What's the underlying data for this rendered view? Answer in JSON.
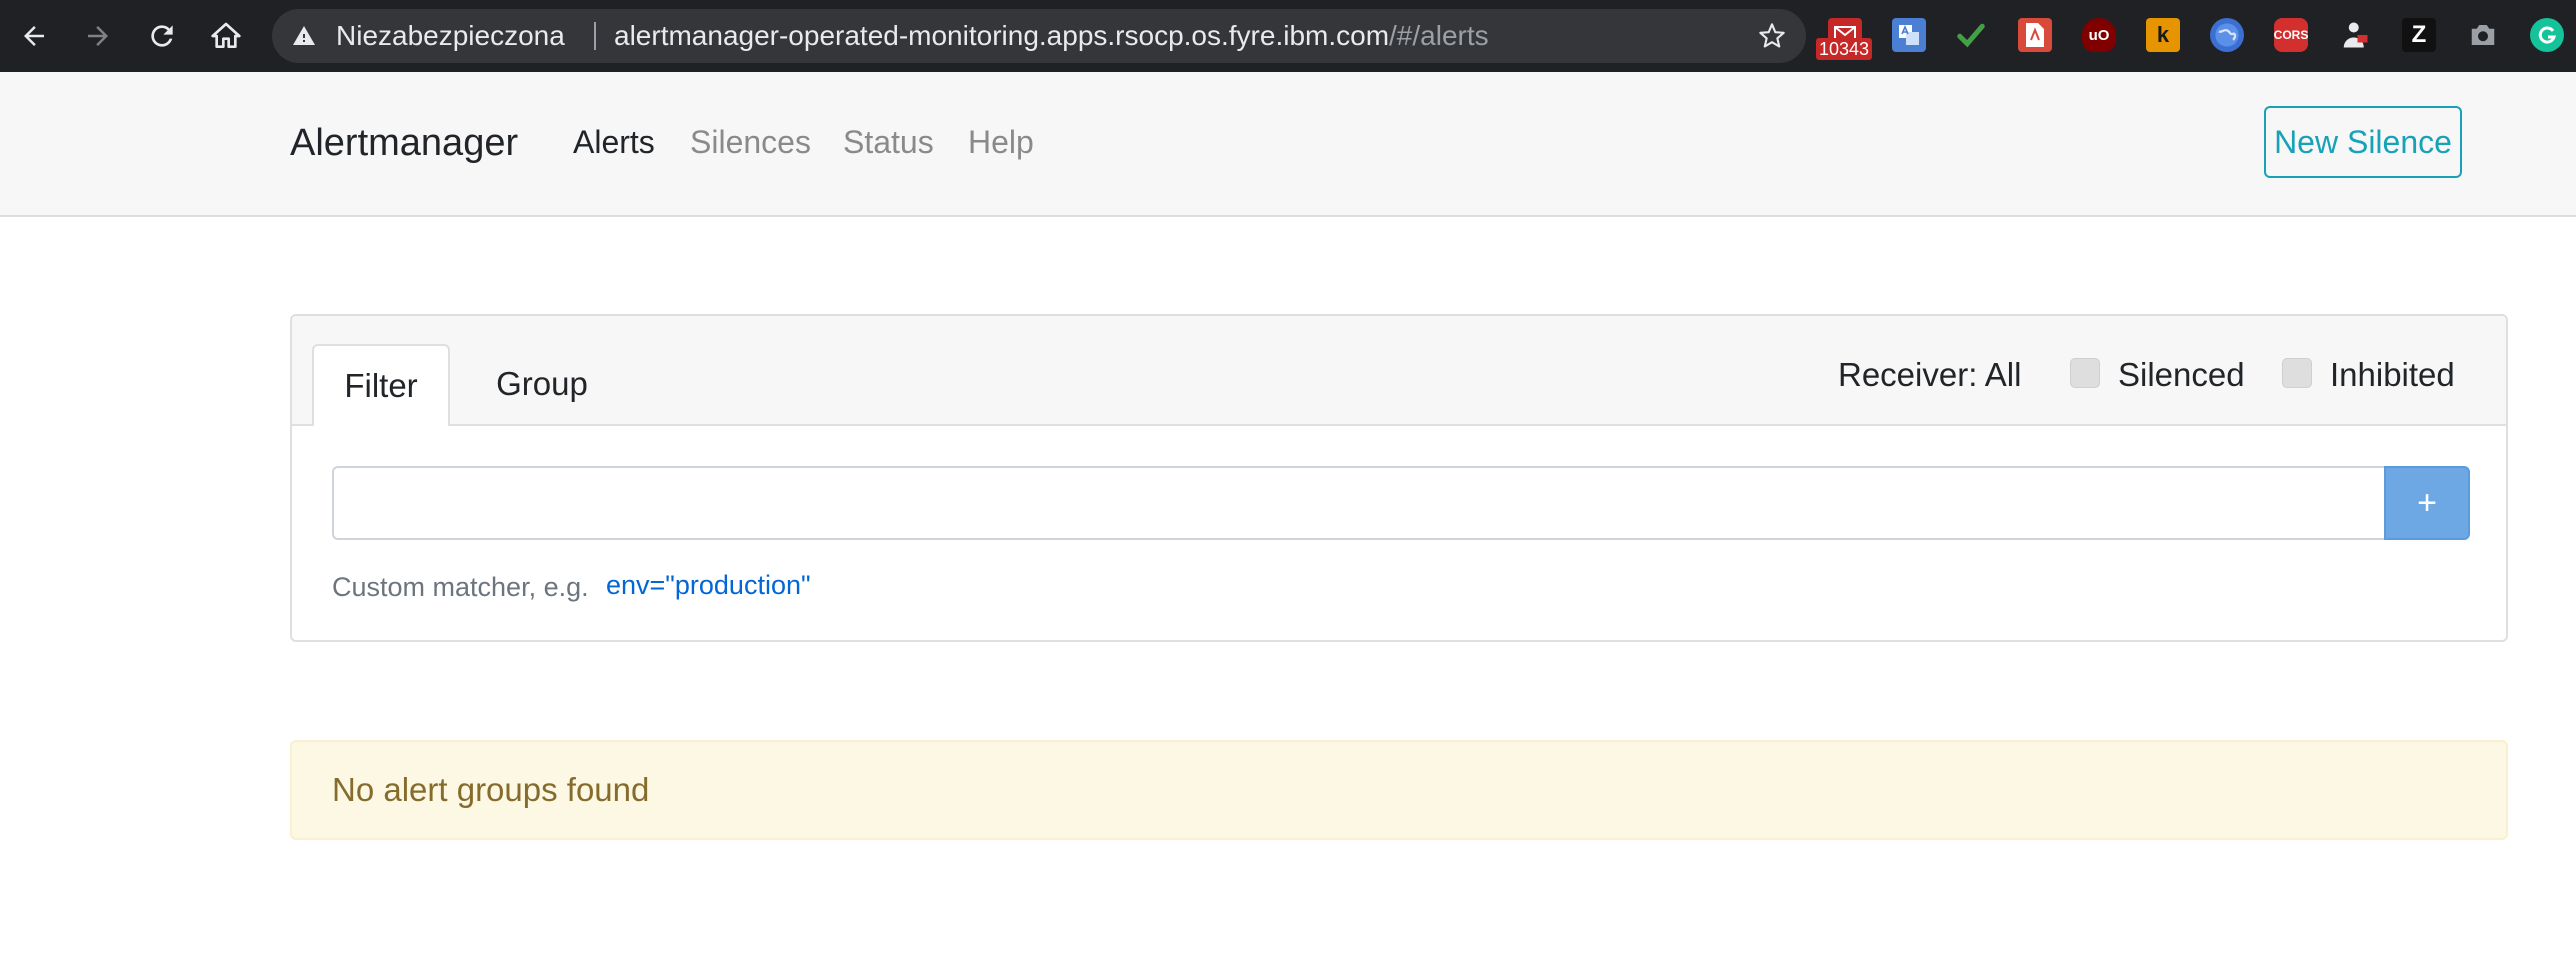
{
  "browser": {
    "insecure_label": "Niezabezpieczona",
    "url_host": "alertmanager-operated-monitoring.apps.rsocp.os.fyre.ibm.com",
    "url_path": "/#/alerts",
    "mail_badge": "10343",
    "extension_labels": {
      "cors": "CORS",
      "k": "k",
      "z": "Z",
      "ub": "uO"
    }
  },
  "navbar": {
    "brand": "Alertmanager",
    "links": [
      {
        "label": "Alerts",
        "active": true
      },
      {
        "label": "Silences",
        "active": false
      },
      {
        "label": "Status",
        "active": false
      },
      {
        "label": "Help",
        "active": false
      }
    ],
    "new_silence_label": "New Silence"
  },
  "filter_card": {
    "tabs": [
      {
        "label": "Filter",
        "active": true
      },
      {
        "label": "Group",
        "active": false
      }
    ],
    "receiver_label": "Receiver: All",
    "silenced_label": "Silenced",
    "inhibited_label": "Inhibited",
    "input_value": "",
    "add_button_label": "+",
    "hint_text": "Custom matcher, e.g.",
    "hint_example": "env=\"production\""
  },
  "alert": {
    "message": "No alert groups found"
  },
  "colors": {
    "accent": "#17a2b8",
    "link": "#0366d6",
    "add_button": "#6ea8e4",
    "warning_bg": "#fdf8e3",
    "warning_text": "#856c2d"
  }
}
